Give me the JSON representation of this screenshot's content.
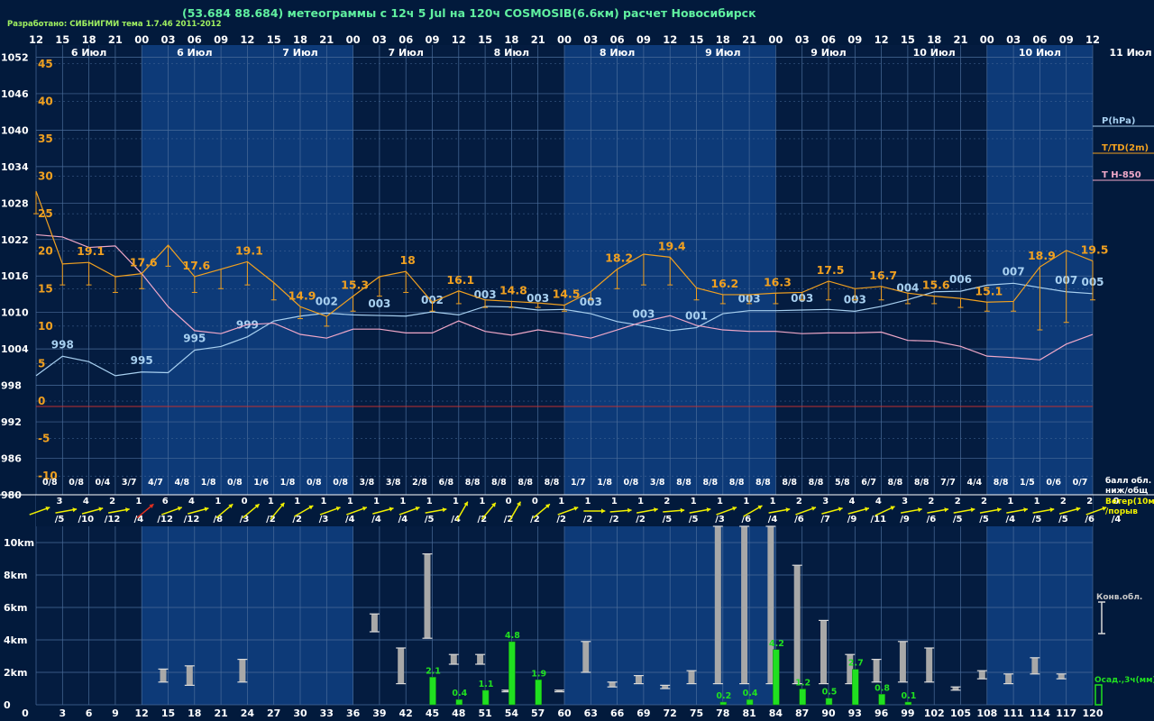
{
  "header": {
    "developer": "Разработано: СИБНИГМИ тема 1.7.46 2011-2012",
    "title": "(53.684 88.684) метеограммы с  12ч 5 Jul на 120ч COSMOSIB(6.6км) расчет Новосибирск"
  },
  "colors": {
    "background": "#021a3c",
    "band_light": "#0d3a78",
    "band_dark": "#041c40",
    "grid": "#4a6c9a",
    "temperature": "#f0a020",
    "pressure": "#a8d0f0",
    "t850": "#f0a8c8",
    "wind": "#f0f000",
    "cloud": "#a8a8a8",
    "precip": "#20e020",
    "text": "#ffffff"
  },
  "chart_data": [
    {
      "name": "meteogram-main",
      "type": "line",
      "hours": [
        0,
        3,
        6,
        9,
        12,
        15,
        18,
        21,
        24,
        27,
        30,
        33,
        36,
        39,
        42,
        45,
        48,
        51,
        54,
        57,
        60,
        63,
        66,
        69,
        72,
        75,
        78,
        81,
        84,
        87,
        90,
        93,
        96,
        99,
        102,
        105,
        108,
        111,
        114,
        117,
        120
      ],
      "time_labels": [
        "12",
        "15",
        "18",
        "21",
        "00",
        "03",
        "06",
        "09",
        "12",
        "15",
        "18",
        "21",
        "00",
        "03",
        "06",
        "09",
        "12",
        "15",
        "18",
        "21",
        "00",
        "03",
        "06",
        "09",
        "12",
        "15",
        "18",
        "21",
        "00",
        "03",
        "06",
        "09",
        "12",
        "15",
        "18",
        "21",
        "00",
        "03",
        "06",
        "09",
        "12"
      ],
      "day_labels": [
        "6 Июл",
        "6 Июл",
        "7 Июл",
        "7 Июл",
        "8 Июл",
        "8 Июл",
        "9 Июл",
        "9 Июл",
        "10 Июл",
        "10 Июл",
        "11 Июл"
      ],
      "pressure_axis": {
        "ticks": [
          1052,
          1046,
          1040,
          1034,
          1028,
          1022,
          1016,
          1010,
          1004,
          998,
          992,
          986,
          980
        ],
        "range": [
          980,
          1054
        ]
      },
      "temperature_axis": {
        "ticks": [
          45,
          40,
          35,
          30,
          25,
          20,
          15,
          10,
          5,
          0,
          -5,
          -10
        ],
        "range": [
          -12.5,
          47.5
        ]
      },
      "series": [
        {
          "name": "P(hPa)",
          "unit": "hPa",
          "values": [
            999.6,
            1002.8,
            1001.9,
            999.6,
            1000.2,
            1000.1,
            1003.8,
            1004.4,
            1006.0,
            1008.6,
            1009.4,
            1009.9,
            1009.6,
            1009.5,
            1009.4,
            1010.1,
            1009.6,
            1011.0,
            1010.9,
            1010.4,
            1010.5,
            1009.8,
            1008.5,
            1007.8,
            1007.0,
            1007.5,
            1009.8,
            1010.3,
            1010.3,
            1010.4,
            1010.5,
            1010.2,
            1011.0,
            1012.1,
            1013.4,
            1013.5,
            1014.5,
            1014.8,
            1014.1,
            1013.4,
            1013.1
          ],
          "labels": [
            {
              "i": 1,
              "text": "998"
            },
            {
              "i": 4,
              "text": "995"
            },
            {
              "i": 6,
              "text": "995"
            },
            {
              "i": 8,
              "text": "999"
            },
            {
              "i": 11,
              "text": "002"
            },
            {
              "i": 13,
              "text": "003"
            },
            {
              "i": 15,
              "text": "002"
            },
            {
              "i": 17,
              "text": "003"
            },
            {
              "i": 19,
              "text": "003"
            },
            {
              "i": 21,
              "text": "003"
            },
            {
              "i": 23,
              "text": "003"
            },
            {
              "i": 25,
              "text": "001"
            },
            {
              "i": 27,
              "text": "003"
            },
            {
              "i": 29,
              "text": "003"
            },
            {
              "i": 31,
              "text": "003"
            },
            {
              "i": 33,
              "text": "004"
            },
            {
              "i": 35,
              "text": "006"
            },
            {
              "i": 37,
              "text": "007"
            },
            {
              "i": 39,
              "text": "007"
            },
            {
              "i": 41,
              "text": "005"
            }
          ]
        },
        {
          "name": "T/TD(2m)",
          "unit": "°C",
          "values": [
            28.0,
            18.3,
            18.5,
            16.6,
            17.0,
            20.8,
            16.6,
            17.6,
            18.6,
            15.8,
            12.6,
            11.3,
            14.0,
            16.6,
            17.3,
            13.2,
            14.7,
            13.5,
            13.3,
            13.1,
            12.8,
            14.6,
            17.6,
            19.6,
            19.2,
            15.1,
            14.2,
            14.2,
            14.4,
            14.5,
            16.0,
            15.0,
            15.3,
            14.4,
            14.0,
            13.7,
            13.2,
            13.3,
            17.9,
            20.1,
            18.7
          ],
          "min_values": [
            25.0,
            15.5,
            15.5,
            14.5,
            15.0,
            18.0,
            14.5,
            15.0,
            15.5,
            13.5,
            11.0,
            10.0,
            12.0,
            14.0,
            14.5,
            12.0,
            13.0,
            12.5,
            12.5,
            12.5,
            12.0,
            13.5,
            15.0,
            15.5,
            15.5,
            13.5,
            13.0,
            13.0,
            13.0,
            13.5,
            13.5,
            13.5,
            13.5,
            13.0,
            13.0,
            12.5,
            12.0,
            12.0,
            9.5,
            10.5,
            13.5
          ],
          "labels": [
            {
              "i": 2,
              "text": "19.1"
            },
            {
              "i": 4,
              "text": "17.6"
            },
            {
              "i": 6,
              "text": "17.6"
            },
            {
              "i": 8,
              "text": "19.1"
            },
            {
              "i": 10,
              "text": "14.9"
            },
            {
              "i": 12,
              "text": "15.3"
            },
            {
              "i": 14,
              "text": "18"
            },
            {
              "i": 16,
              "text": "16.1"
            },
            {
              "i": 18,
              "text": "14.8"
            },
            {
              "i": 20,
              "text": "14.5"
            },
            {
              "i": 22,
              "text": "18.2"
            },
            {
              "i": 24,
              "text": "19.4"
            },
            {
              "i": 26,
              "text": "16.2"
            },
            {
              "i": 28,
              "text": "16.3"
            },
            {
              "i": 30,
              "text": "17.5"
            },
            {
              "i": 32,
              "text": "16.7"
            },
            {
              "i": 34,
              "text": "15.6"
            },
            {
              "i": 36,
              "text": "15.1"
            },
            {
              "i": 38,
              "text": "18.9"
            },
            {
              "i": 40,
              "text": "19.5"
            }
          ]
        },
        {
          "name": "T H-850",
          "unit": "°C",
          "values": [
            22.2,
            21.9,
            20.5,
            20.7,
            17.0,
            12.6,
            9.4,
            9.0,
            10.2,
            10.4,
            8.9,
            8.4,
            9.6,
            9.6,
            9.1,
            9.1,
            10.7,
            9.3,
            8.8,
            9.5,
            9.0,
            8.4,
            9.5,
            10.6,
            11.4,
            10.1,
            9.5,
            9.3,
            9.3,
            9.0,
            9.1,
            9.1,
            9.2,
            8.1,
            8.0,
            7.3,
            6.0,
            5.8,
            5.5,
            7.6,
            8.9
          ]
        }
      ],
      "cloud_fraction_labels": [
        "0/8",
        "0/8",
        "0/4",
        "3/7",
        "4/7",
        "4/8",
        "1/8",
        "0/8",
        "1/6",
        "1/8",
        "0/8",
        "0/8",
        "3/8",
        "3/8",
        "2/8",
        "6/8",
        "8/8",
        "8/8",
        "8/8",
        "8/8",
        "1/7",
        "1/8",
        "0/8",
        "3/8",
        "8/8",
        "8/8",
        "8/8",
        "8/8",
        "8/8",
        "8/8",
        "5/8",
        "6/7",
        "8/8",
        "8/8",
        "7/7",
        "4/4",
        "8/8",
        "1/5",
        "0/6",
        "0/7"
      ],
      "legend_labels": {
        "cloud": "балл обл.",
        "cloud2": "ниж/общ"
      }
    },
    {
      "name": "wind",
      "type": "table",
      "speed": [
        "3",
        "4",
        "2",
        "1",
        "6",
        "4",
        "1",
        "0",
        "1",
        "1",
        "1",
        "1",
        "1",
        "1",
        "1",
        "1",
        "1",
        "0",
        "0",
        "1",
        "1",
        "1",
        "1",
        "2",
        "1",
        "1",
        "1",
        "1",
        "2",
        "3",
        "4",
        "4",
        "3",
        "2",
        "2",
        "2",
        "1",
        "1",
        "2",
        "2",
        "0"
      ],
      "gust": [
        "/5",
        "/10",
        "/12",
        "/4",
        "/12",
        "/12",
        "/8",
        "/3",
        "/2",
        "/2",
        "/3",
        "/4",
        "/4",
        "/4",
        "/5",
        "/4",
        "/2",
        "/2",
        "/2",
        "/2",
        "/2",
        "/2",
        "/2",
        "/5",
        "/5",
        "/3",
        "/6",
        "/4",
        "/6",
        "/7",
        "/9",
        "/11",
        "/9",
        "/6",
        "/5",
        "/5",
        "/4",
        "/5",
        "/5",
        "/6",
        "/4"
      ],
      "direction_deg": [
        -20,
        -10,
        -15,
        -10,
        -40,
        -20,
        -15,
        -40,
        -40,
        -50,
        -30,
        -20,
        -20,
        -15,
        -20,
        -10,
        -60,
        -50,
        -60,
        -40,
        -20,
        0,
        -5,
        -10,
        -5,
        -10,
        -20,
        -30,
        -10,
        -20,
        -15,
        -15,
        -25,
        -10,
        -10,
        -10,
        -10,
        -10,
        -10,
        -15,
        -20
      ],
      "label": "Ветер(10м)",
      "label2": "/порыв"
    },
    {
      "name": "convective-cloud-precip",
      "type": "bar",
      "hours_ticks": [
        "0",
        "3",
        "6",
        "9",
        "12",
        "15",
        "18",
        "21",
        "24",
        "27",
        "30",
        "33",
        "36",
        "39",
        "42",
        "45",
        "48",
        "51",
        "54",
        "57",
        "60",
        "63",
        "66",
        "69",
        "72",
        "75",
        "78",
        "81",
        "84",
        "87",
        "90",
        "93",
        "96",
        "99",
        "102",
        "105",
        "108",
        "111",
        "114",
        "117",
        "120"
      ],
      "height_axis": {
        "ticks": [
          "10km",
          "8km",
          "6km",
          "4km",
          "2km",
          "0"
        ],
        "range_km": [
          0,
          11
        ]
      },
      "cloud_bars": [
        {
          "h": 15,
          "base": 1.4,
          "top": 2.2
        },
        {
          "h": 18,
          "base": 1.2,
          "top": 2.4
        },
        {
          "h": 24,
          "base": 1.4,
          "top": 2.8
        },
        {
          "h": 39,
          "base": 4.5,
          "top": 5.6
        },
        {
          "h": 42,
          "base": 1.3,
          "top": 3.5
        },
        {
          "h": 45,
          "base": 4.1,
          "top": 9.3
        },
        {
          "h": 48,
          "base": 2.5,
          "top": 3.1
        },
        {
          "h": 51,
          "base": 2.5,
          "top": 3.1
        },
        {
          "h": 54,
          "base": 0.8,
          "top": 0.9
        },
        {
          "h": 60,
          "base": 0.8,
          "top": 0.9
        },
        {
          "h": 63,
          "base": 2.0,
          "top": 3.9
        },
        {
          "h": 66,
          "base": 1.1,
          "top": 1.4
        },
        {
          "h": 69,
          "base": 1.3,
          "top": 1.8
        },
        {
          "h": 72,
          "base": 1.0,
          "top": 1.2
        },
        {
          "h": 75,
          "base": 1.3,
          "top": 2.1
        },
        {
          "h": 78,
          "base": 1.3,
          "top": 11.0
        },
        {
          "h": 81,
          "base": 1.3,
          "top": 11.0
        },
        {
          "h": 84,
          "base": 1.3,
          "top": 11.0
        },
        {
          "h": 87,
          "base": 1.3,
          "top": 8.6
        },
        {
          "h": 90,
          "base": 1.3,
          "top": 5.2
        },
        {
          "h": 93,
          "base": 1.3,
          "top": 3.1
        },
        {
          "h": 96,
          "base": 1.4,
          "top": 2.8
        },
        {
          "h": 99,
          "base": 1.4,
          "top": 3.9
        },
        {
          "h": 102,
          "base": 1.4,
          "top": 3.5
        },
        {
          "h": 105,
          "base": 0.9,
          "top": 1.1
        },
        {
          "h": 108,
          "base": 1.6,
          "top": 2.1
        },
        {
          "h": 111,
          "base": 1.3,
          "top": 1.9
        },
        {
          "h": 114,
          "base": 1.9,
          "top": 2.9
        },
        {
          "h": 117,
          "base": 1.6,
          "top": 1.9
        }
      ],
      "precip_bars": [
        {
          "h": 45,
          "value": 2.1
        },
        {
          "h": 48,
          "value": 0.4
        },
        {
          "h": 51,
          "value": 1.1
        },
        {
          "h": 54,
          "value": 4.8
        },
        {
          "h": 57,
          "value": 1.9
        },
        {
          "h": 78,
          "value": 0.2
        },
        {
          "h": 81,
          "value": 0.4
        },
        {
          "h": 84,
          "value": 4.2
        },
        {
          "h": 87,
          "value": 1.2
        },
        {
          "h": 90,
          "value": 0.5
        },
        {
          "h": 93,
          "value": 2.7
        },
        {
          "h": 96,
          "value": 0.8
        },
        {
          "h": 99,
          "value": 0.1
        }
      ],
      "legend_labels": {
        "cloud": "Конв.обл.",
        "precip": "Осад.,3ч(мм)"
      }
    }
  ]
}
